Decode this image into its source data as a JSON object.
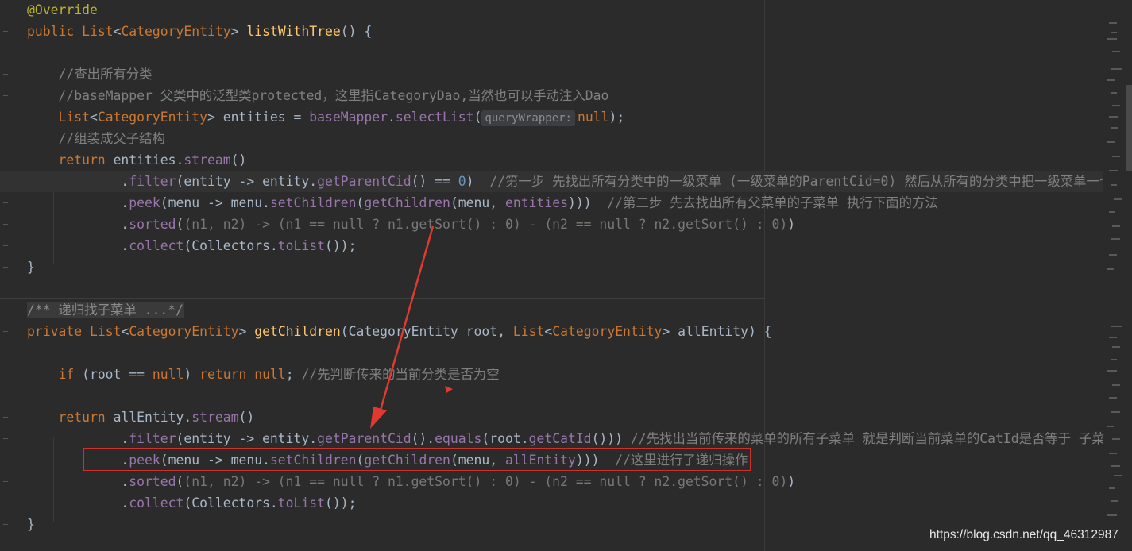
{
  "editor": {
    "lines": [
      {
        "id": "l1",
        "tokens": [
          {
            "c": "ann",
            "t": "@Override"
          }
        ]
      },
      {
        "id": "l2",
        "tokens": [
          {
            "c": "kw",
            "t": "public "
          },
          {
            "c": "kw",
            "t": "List"
          },
          {
            "c": "typ",
            "t": "<"
          },
          {
            "c": "kw",
            "t": "CategoryEntity"
          },
          {
            "c": "typ",
            "t": "> "
          },
          {
            "c": "fn",
            "t": "listWithTree"
          },
          {
            "c": "typ",
            "t": "() {"
          }
        ]
      },
      {
        "id": "l3",
        "tokens": []
      },
      {
        "id": "l4",
        "tokens": [
          {
            "c": "cm",
            "t": "    //查出所有分类"
          }
        ]
      },
      {
        "id": "l5",
        "tokens": [
          {
            "c": "cm",
            "t": "    //baseMapper 父类中的泛型类protected，这里指CategoryDao,当然也可以手动注入Dao"
          }
        ]
      },
      {
        "id": "l6",
        "tokens": [
          {
            "c": "kw",
            "t": "    List"
          },
          {
            "c": "typ",
            "t": "<"
          },
          {
            "c": "kw",
            "t": "CategoryEntity"
          },
          {
            "c": "typ",
            "t": "> entities = "
          },
          {
            "c": "fld",
            "t": "baseMapper"
          },
          {
            "c": "typ",
            "t": "."
          },
          {
            "c": "mc",
            "t": "selectList"
          },
          {
            "c": "typ",
            "t": "("
          },
          {
            "c": "hint",
            "t": "queryWrapper:"
          },
          {
            "c": "kw",
            "t": "null"
          },
          {
            "c": "typ",
            "t": ");"
          }
        ]
      },
      {
        "id": "l7",
        "tokens": [
          {
            "c": "cm",
            "t": "    //组装成父子结构"
          }
        ]
      },
      {
        "id": "l8",
        "tokens": [
          {
            "c": "kw",
            "t": "    return "
          },
          {
            "c": "typ",
            "t": "entities."
          },
          {
            "c": "mc",
            "t": "stream"
          },
          {
            "c": "typ",
            "t": "()"
          }
        ]
      },
      {
        "id": "l9",
        "hl": true,
        "tokens": [
          {
            "c": "typ",
            "t": "            ."
          },
          {
            "c": "mc",
            "t": "filter"
          },
          {
            "c": "typ",
            "t": "(entity -> entity."
          },
          {
            "c": "mc",
            "t": "getParentCid"
          },
          {
            "c": "typ",
            "t": "() == "
          },
          {
            "c": "num",
            "t": "0"
          },
          {
            "c": "typ",
            "t": ")  "
          },
          {
            "c": "cm",
            "t": "//第一步 先找出所有分类中的一级菜单 (一级菜单的ParentCid=0) 然后从所有的分类中把一级菜单一个个的过"
          }
        ]
      },
      {
        "id": "l10",
        "tokens": [
          {
            "c": "typ",
            "t": "            ."
          },
          {
            "c": "mc",
            "t": "peek"
          },
          {
            "c": "typ",
            "t": "(menu -> menu."
          },
          {
            "c": "mc",
            "t": "setChildren"
          },
          {
            "c": "typ",
            "t": "("
          },
          {
            "c": "mc",
            "t": "getChildren"
          },
          {
            "c": "typ",
            "t": "(menu, "
          },
          {
            "c": "fld",
            "t": "entities"
          },
          {
            "c": "typ",
            "t": ")))  "
          },
          {
            "c": "cm",
            "t": "//第二步 先去找出所有父菜单的子菜单 执行下面的方法"
          }
        ]
      },
      {
        "id": "l11",
        "tokens": [
          {
            "c": "typ",
            "t": "            ."
          },
          {
            "c": "mc",
            "t": "sorted"
          },
          {
            "c": "typ",
            "t": "("
          },
          {
            "c": "dim",
            "t": "(n1, n2) -> (n1 == null ? n1.getSort() : 0) - (n2 == null ? n2.getSort() : 0)"
          },
          {
            "c": "typ",
            "t": ")"
          }
        ]
      },
      {
        "id": "l12",
        "tokens": [
          {
            "c": "typ",
            "t": "            ."
          },
          {
            "c": "mc",
            "t": "collect"
          },
          {
            "c": "typ",
            "t": "(Collectors."
          },
          {
            "c": "mc",
            "t": "toList"
          },
          {
            "c": "typ",
            "t": "());"
          }
        ]
      },
      {
        "id": "l13",
        "tokens": [
          {
            "c": "typ",
            "t": "}"
          }
        ]
      },
      {
        "id": "l14",
        "tokens": []
      },
      {
        "id": "l15",
        "tokens": [
          {
            "c": "doc",
            "t": "/** 递归找子菜单 ...*/"
          }
        ]
      },
      {
        "id": "l16",
        "tokens": [
          {
            "c": "kw",
            "t": "private "
          },
          {
            "c": "kw",
            "t": "List"
          },
          {
            "c": "typ",
            "t": "<"
          },
          {
            "c": "kw",
            "t": "CategoryEntity"
          },
          {
            "c": "typ",
            "t": "> "
          },
          {
            "c": "fn",
            "t": "getChildren"
          },
          {
            "c": "typ",
            "t": "(CategoryEntity root, "
          },
          {
            "c": "kw",
            "t": "List"
          },
          {
            "c": "typ",
            "t": "<"
          },
          {
            "c": "kw",
            "t": "CategoryEntity"
          },
          {
            "c": "typ",
            "t": "> allEntity) {"
          }
        ]
      },
      {
        "id": "l17",
        "tokens": []
      },
      {
        "id": "l18",
        "tokens": [
          {
            "c": "kw",
            "t": "    if "
          },
          {
            "c": "typ",
            "t": "(root == "
          },
          {
            "c": "kw",
            "t": "null"
          },
          {
            "c": "typ",
            "t": ") "
          },
          {
            "c": "kw",
            "t": "return null"
          },
          {
            "c": "typ",
            "t": "; "
          },
          {
            "c": "cm",
            "t": "//先判断传来的当前分类是否为空"
          }
        ]
      },
      {
        "id": "l19",
        "tokens": []
      },
      {
        "id": "l20",
        "tokens": [
          {
            "c": "kw",
            "t": "    return "
          },
          {
            "c": "typ",
            "t": "allEntity."
          },
          {
            "c": "mc",
            "t": "stream"
          },
          {
            "c": "typ",
            "t": "()"
          }
        ]
      },
      {
        "id": "l21",
        "tokens": [
          {
            "c": "typ",
            "t": "            ."
          },
          {
            "c": "mc",
            "t": "filter"
          },
          {
            "c": "typ",
            "t": "(entity -> entity."
          },
          {
            "c": "mc",
            "t": "getParentCid"
          },
          {
            "c": "typ",
            "t": "()."
          },
          {
            "c": "mc",
            "t": "equals"
          },
          {
            "c": "typ",
            "t": "(root."
          },
          {
            "c": "mc",
            "t": "getCatId"
          },
          {
            "c": "typ",
            "t": "())) "
          },
          {
            "c": "cm",
            "t": "//先找出当前传来的菜单的所有子菜单 就是判断当前菜单的CatId是否等于 子菜单的Pa"
          }
        ]
      },
      {
        "id": "l22",
        "tokens": [
          {
            "c": "typ",
            "t": "            ."
          },
          {
            "c": "mc",
            "t": "peek"
          },
          {
            "c": "typ",
            "t": "(menu -> menu."
          },
          {
            "c": "mc",
            "t": "setChildren"
          },
          {
            "c": "typ",
            "t": "("
          },
          {
            "c": "mc",
            "t": "getChildren"
          },
          {
            "c": "typ",
            "t": "(menu, "
          },
          {
            "c": "fld",
            "t": "allEntity"
          },
          {
            "c": "typ",
            "t": ")))  "
          },
          {
            "c": "cm",
            "t": "//这里进行了递归操作"
          }
        ]
      },
      {
        "id": "l23",
        "tokens": [
          {
            "c": "typ",
            "t": "            ."
          },
          {
            "c": "mc",
            "t": "sorted"
          },
          {
            "c": "typ",
            "t": "("
          },
          {
            "c": "dim",
            "t": "(n1, n2) -> (n1 == null ? n1.getSort() : 0) - (n2 == null ? n2.getSort() : 0)"
          },
          {
            "c": "typ",
            "t": ")"
          }
        ]
      },
      {
        "id": "l24",
        "tokens": [
          {
            "c": "typ",
            "t": "            ."
          },
          {
            "c": "mc",
            "t": "collect"
          },
          {
            "c": "typ",
            "t": "(Collectors."
          },
          {
            "c": "mc",
            "t": "toList"
          },
          {
            "c": "typ",
            "t": "());"
          }
        ]
      },
      {
        "id": "l25",
        "tokens": [
          {
            "c": "typ",
            "t": "}"
          }
        ]
      }
    ]
  },
  "colors": {
    "background": "#2b2b2b",
    "keyword": "#cc7832",
    "method": "#ffc66d",
    "field": "#9876aa",
    "comment": "#808080",
    "annotation_red": "#d0302a"
  },
  "watermark": "https://blog.csdn.net/qq_46312987"
}
